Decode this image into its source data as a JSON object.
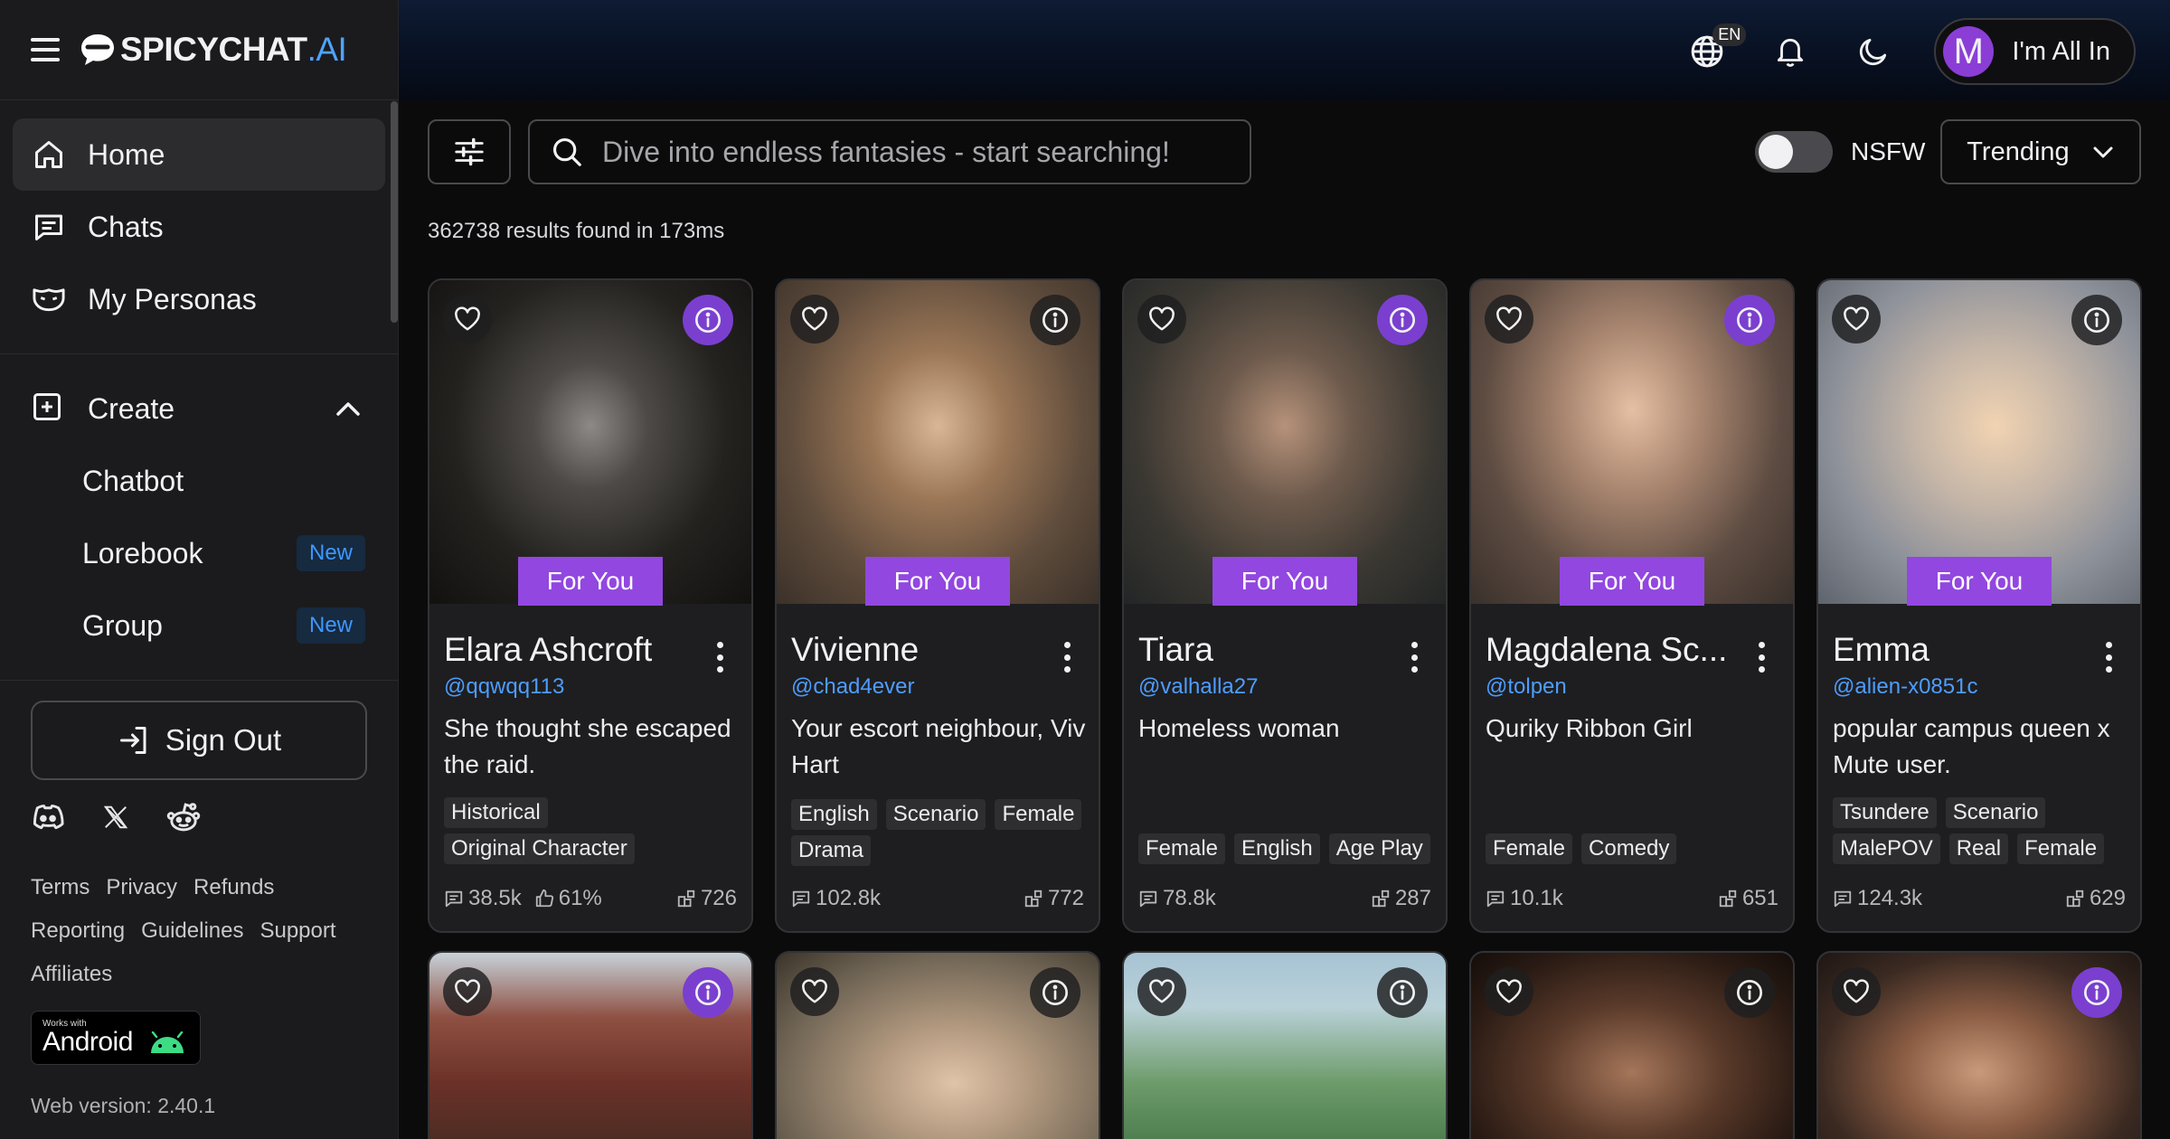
{
  "brand": {
    "name": "SPICYCHAT",
    "suffix": ".AI"
  },
  "sidebar": {
    "nav": [
      {
        "label": "Home",
        "icon": "home-icon",
        "active": true
      },
      {
        "label": "Chats",
        "icon": "chat-icon",
        "active": false
      },
      {
        "label": "My Personas",
        "icon": "mask-icon",
        "active": false
      }
    ],
    "create": {
      "label": "Create",
      "icon": "plus-square-icon"
    },
    "create_items": [
      {
        "label": "Chatbot",
        "badge": ""
      },
      {
        "label": "Lorebook",
        "badge": "New"
      },
      {
        "label": "Group",
        "badge": "New"
      }
    ],
    "sign_out": "Sign Out",
    "footer_links": [
      "Terms",
      "Privacy",
      "Refunds",
      "Reporting",
      "Guidelines",
      "Support",
      "Affiliates"
    ],
    "android_small": "Works with",
    "android_big": "Android",
    "version": "Web version: 2.40.1"
  },
  "header": {
    "language": "EN",
    "user_initial": "M",
    "user_name": "I'm All In"
  },
  "toolbar": {
    "search_placeholder": "Dive into endless fantasies - start searching!",
    "nsfw_label": "NSFW",
    "nsfw_on": false,
    "sort": "Trending",
    "results_text": "362738 results found in 173ms"
  },
  "colors": {
    "accent": "#9247e0",
    "link": "#4e9dff",
    "bg": "#0b0b0c",
    "card": "#1e1e20"
  },
  "cards": [
    {
      "name": "Elara Ashcroft",
      "handle": "@qqwqq113",
      "badge": "For You",
      "desc": "She thought she escaped the raid.",
      "tags": [
        "Historical",
        "Original Character"
      ],
      "messages": "38.5k",
      "likes": "61%",
      "bots": "726",
      "info_style": "purple"
    },
    {
      "name": "Vivienne",
      "handle": "@chad4ever",
      "badge": "For You",
      "desc": "Your escort neighbour, Viv Hart",
      "tags": [
        "English",
        "Scenario",
        "Female",
        "Drama"
      ],
      "messages": "102.8k",
      "likes": "",
      "bots": "772",
      "info_style": "dark"
    },
    {
      "name": "Tiara",
      "handle": "@valhalla27",
      "badge": "For You",
      "desc": "Homeless woman",
      "tags": [
        "Female",
        "English",
        "Age Play"
      ],
      "messages": "78.8k",
      "likes": "",
      "bots": "287",
      "info_style": "purple"
    },
    {
      "name": "Magdalena Sc...",
      "handle": "@tolpen",
      "badge": "For You",
      "desc": "Quriky Ribbon Girl",
      "tags": [
        "Female",
        "Comedy"
      ],
      "messages": "10.1k",
      "likes": "",
      "bots": "651",
      "info_style": "purple"
    },
    {
      "name": "Emma",
      "handle": "@alien-x0851c",
      "badge": "For You",
      "desc": "popular campus queen x Mute user.",
      "tags": [
        "Tsundere",
        "Scenario",
        "MalePOV",
        "Real",
        "Female"
      ],
      "messages": "124.3k",
      "likes": "",
      "bots": "629",
      "info_style": "dark"
    }
  ],
  "row2_info_styles": [
    "purple",
    "dark",
    "dark",
    "dark",
    "purple"
  ]
}
